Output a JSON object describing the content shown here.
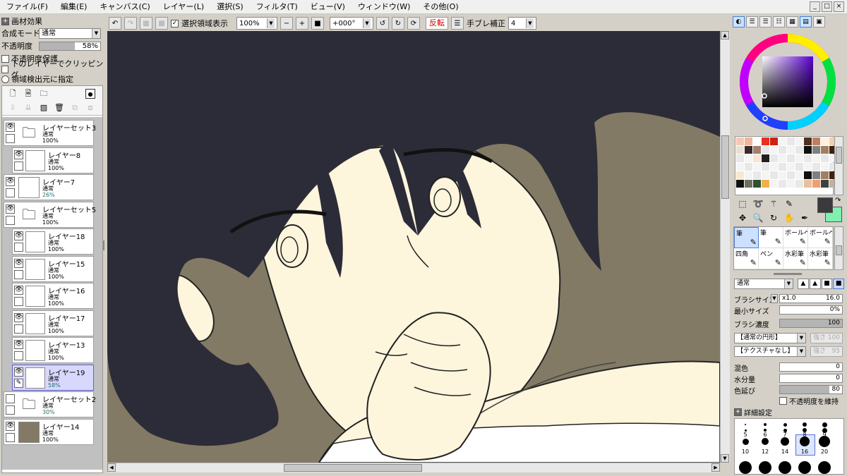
{
  "menu": [
    "ファイル(F)",
    "編集(E)",
    "キャンバス(C)",
    "レイヤー(L)",
    "選択(S)",
    "フィルタ(T)",
    "ビュー(V)",
    "ウィンドウ(W)",
    "その他(O)"
  ],
  "window_buttons": [
    "_",
    "□",
    "×"
  ],
  "toolbar": {
    "show_selection_label": "選択領域表示",
    "zoom": "100%",
    "rotation": "+000°",
    "flip_label": "反転",
    "stabilizer_label": "手ブレ補正",
    "stabilizer_value": "4"
  },
  "left": {
    "effects_label": "画材効果",
    "blend_label": "合成モード",
    "blend_value": "通常",
    "opacity_label": "不透明度",
    "opacity_value": "58%",
    "opacity_fraction": 0.58,
    "protect_label": "不透明度保護",
    "clip_label": "下のレイヤーでクリッピング",
    "source_label": "領域検出元に指定"
  },
  "layers": [
    {
      "name": "レイヤーセット3",
      "mode": "通常",
      "opacity": "100%"
    },
    {
      "name": "レイヤー8",
      "mode": "通常",
      "opacity": "100%"
    },
    {
      "name": "レイヤー7",
      "mode": "通常",
      "opacity": "26%"
    },
    {
      "name": "レイヤーセット5",
      "mode": "通常",
      "opacity": "100%"
    },
    {
      "name": "レイヤー18",
      "mode": "通常",
      "opacity": "100%"
    },
    {
      "name": "レイヤー15",
      "mode": "通常",
      "opacity": "100%"
    },
    {
      "name": "レイヤー16",
      "mode": "通常",
      "opacity": "100%"
    },
    {
      "name": "レイヤー17",
      "mode": "通常",
      "opacity": "100%"
    },
    {
      "name": "レイヤー13",
      "mode": "通常",
      "opacity": "100%"
    },
    {
      "name": "レイヤー19",
      "mode": "通常",
      "opacity": "58%"
    },
    {
      "name": "レイヤーセット2",
      "mode": "通常",
      "opacity": "30%"
    },
    {
      "name": "レイヤー14",
      "mode": "通常",
      "opacity": "100%"
    }
  ],
  "colors": {
    "canvas_bg": "#827a65",
    "skin": "#fdf5dc",
    "hair": "#2c2c38",
    "accent": "#4a7fd0",
    "current_color": "#3a3a3c",
    "secondary_color": "#7ff0b0"
  },
  "brushes": [
    "筆",
    "筆",
    "ボールペン",
    "ボールペン",
    "四角",
    "ペン",
    "水彩筆",
    "水彩筆"
  ],
  "right": {
    "blend_value": "通常",
    "brush_size_label": "ブラシサイズ",
    "size_mult": "x1.0",
    "brush_size_value": "16.0",
    "min_size_label": "最小サイズ",
    "min_size_value": "0%",
    "density_label": "ブラシ濃度",
    "density_value": "100",
    "shape_value": "【通常の円形】",
    "texture_value": "【テクスチャなし】",
    "strength_label": "強さ",
    "strength_value1": "100",
    "strength_value2": "95",
    "mix_label": "混色",
    "mix_value": "0",
    "water_label": "水分量",
    "water_value": "0",
    "persist_label": "色延び",
    "persist_value": "80",
    "keep_opacity_label": "不透明度を維持",
    "detail_label": "詳細設定"
  },
  "brush_sizes": [
    "5",
    "6",
    "7",
    "8",
    "9",
    "10",
    "12",
    "14",
    "16",
    "20"
  ],
  "selected_size": "16"
}
